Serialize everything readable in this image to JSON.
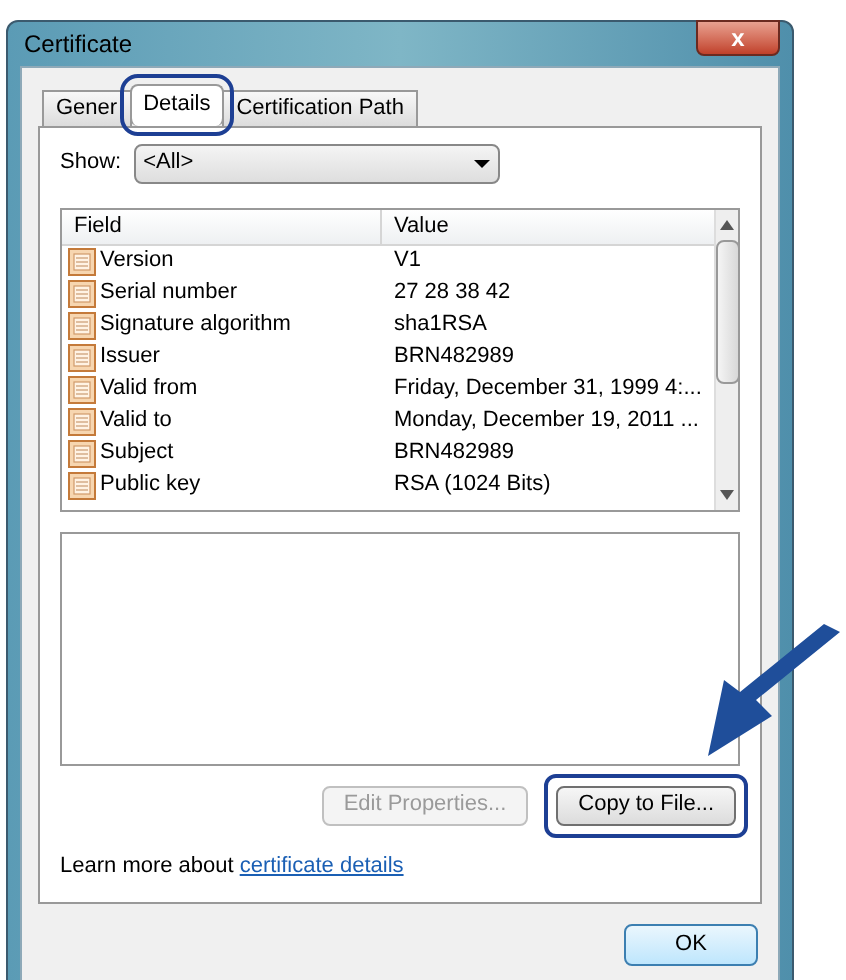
{
  "window": {
    "title": "Certificate",
    "close": "x"
  },
  "tabs": [
    {
      "label": "Gener",
      "selected": false,
      "highlighted": false
    },
    {
      "label": "Details",
      "selected": true,
      "highlighted": true
    },
    {
      "label": "Certification Path",
      "selected": false,
      "highlighted": false
    }
  ],
  "show": {
    "label": "Show:",
    "value": "<All>"
  },
  "fields": {
    "columns": [
      "Field",
      "Value"
    ],
    "rows": [
      {
        "field": "Version",
        "value": "V1",
        "selected": false
      },
      {
        "field": "Serial number",
        "value": "27 28 38 42",
        "selected": false
      },
      {
        "field": "Signature algorithm",
        "value": "sha1RSA",
        "selected": false
      },
      {
        "field": "Issuer",
        "value": "BRN482989",
        "selected": false
      },
      {
        "field": "Valid from",
        "value": "Friday, December 31, 1999 4:...",
        "selected": false
      },
      {
        "field": "Valid to",
        "value": "Monday, December 19, 2011 ...",
        "selected": false
      },
      {
        "field": "Subject",
        "value": "BRN482989",
        "selected": false
      },
      {
        "field": "Public key",
        "value": "RSA (1024 Bits)",
        "selected": false
      }
    ]
  },
  "buttons": [
    {
      "label": "Edit Properties...",
      "disabled": true,
      "highlighted": false
    },
    {
      "label": "Copy to File...",
      "disabled": false,
      "highlighted": true
    }
  ],
  "learn_more": {
    "text": "Learn more about",
    "link": "certificate details"
  },
  "ok": "OK"
}
